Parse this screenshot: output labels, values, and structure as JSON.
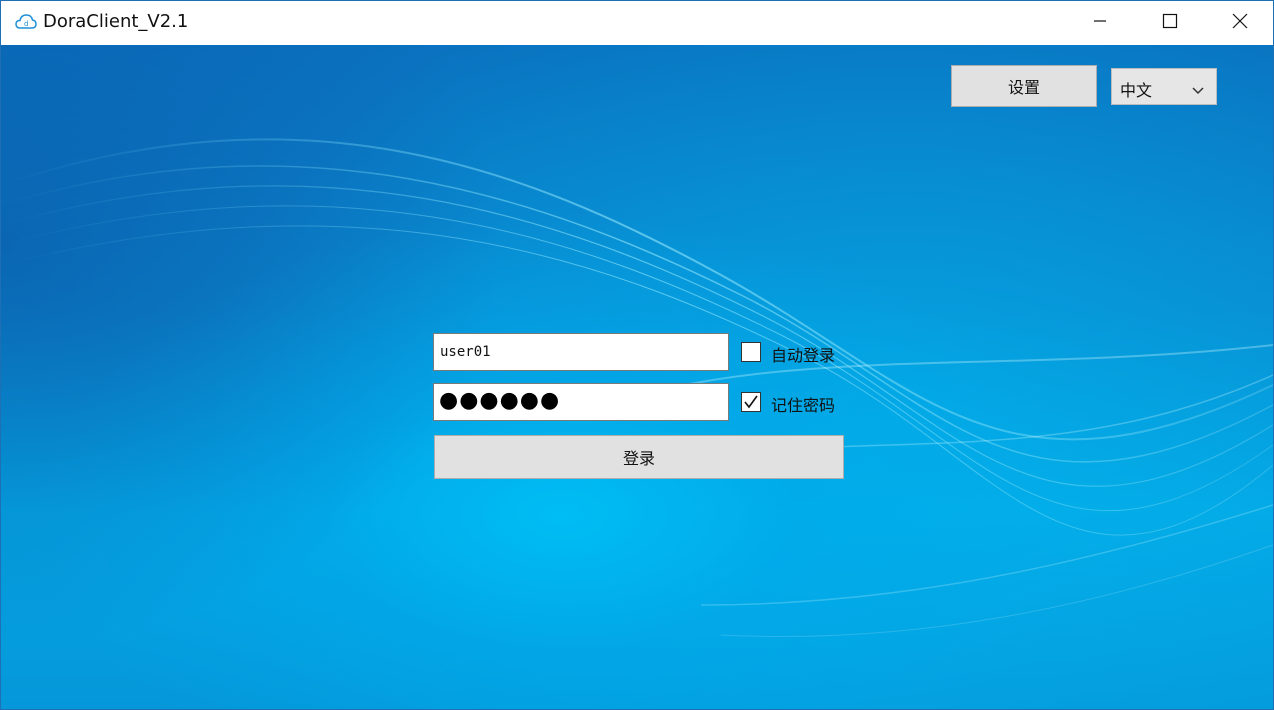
{
  "window": {
    "title": "DoraClient_V2.1",
    "icon": "cloud-icon",
    "controls": [
      "minimize-icon",
      "maximize-icon",
      "close-icon"
    ]
  },
  "toolbar": {
    "settings_label": "设置",
    "language": {
      "selected": "中文",
      "icon": "chevron-down-icon"
    }
  },
  "login": {
    "username": "user01",
    "password_mask": "●●●●●●",
    "auto_login": {
      "label": "自动登录",
      "checked": false
    },
    "remember_password": {
      "label": "记住密码",
      "checked": true
    },
    "submit_label": "登录"
  },
  "colors": {
    "background_top": "#0a72c0",
    "background_glow": "#00bef5",
    "button_bg": "#e1e1e1"
  }
}
